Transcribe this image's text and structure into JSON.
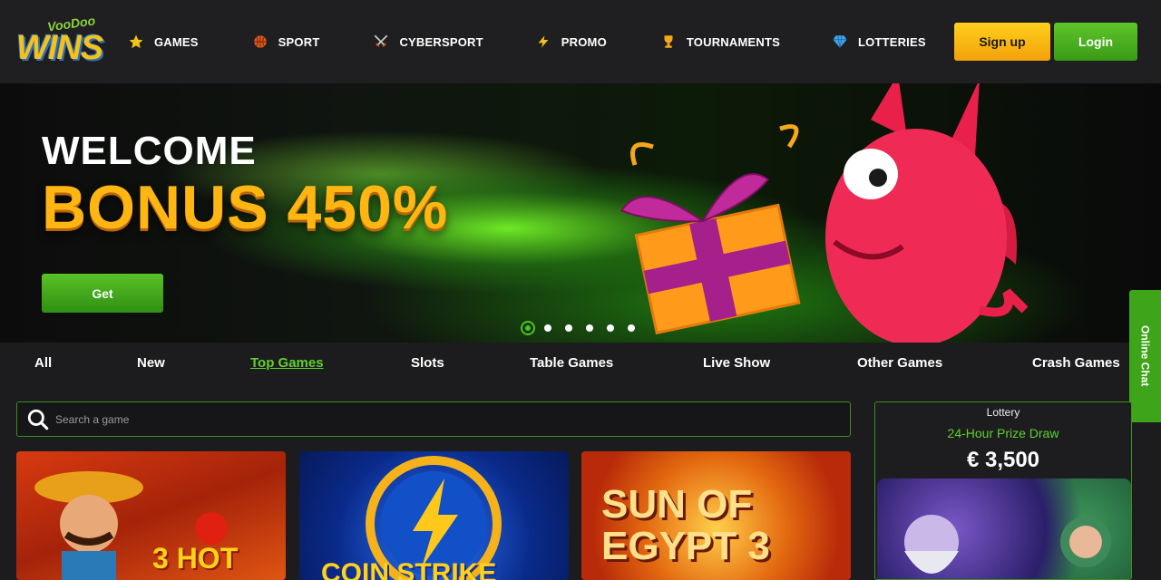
{
  "header": {
    "logo_top": "VooDoo",
    "logo_main": "WINS",
    "nav": [
      {
        "label": "GAMES",
        "icon": "star-icon"
      },
      {
        "label": "SPORT",
        "icon": "basketball-icon"
      },
      {
        "label": "CYBERSPORT",
        "icon": "crossed-swords-icon"
      },
      {
        "label": "PROMO",
        "icon": "lightning-icon"
      },
      {
        "label": "TOURNAMENTS",
        "icon": "trophy-icon"
      },
      {
        "label": "LOTTERIES",
        "icon": "diamond-icon"
      }
    ],
    "signup_label": "Sign up",
    "login_label": "Login"
  },
  "banner": {
    "welcome": "WELCOME",
    "bonus": "BONUS 450%",
    "get_label": "Get",
    "slides": 6,
    "active_slide": 1
  },
  "online_chat": "Online Chat",
  "categories": [
    "All",
    "New",
    "Top Games",
    "Slots",
    "Table Games",
    "Live Show",
    "Other Games",
    "Crash Games"
  ],
  "active_category": "Top Games",
  "search": {
    "placeholder": "Search a game"
  },
  "games": [
    {
      "title": "3 HOT"
    },
    {
      "title": "COIN STRIKE"
    },
    {
      "title": "SUN OF EGYPT 3"
    }
  ],
  "lottery": {
    "label": "Lottery",
    "subtitle": "24-Hour Prize Draw",
    "amount": "€ 3,500"
  },
  "colors": {
    "accent_green": "#4fc026",
    "accent_yellow": "#ffb612",
    "background": "#1c1c1e"
  }
}
